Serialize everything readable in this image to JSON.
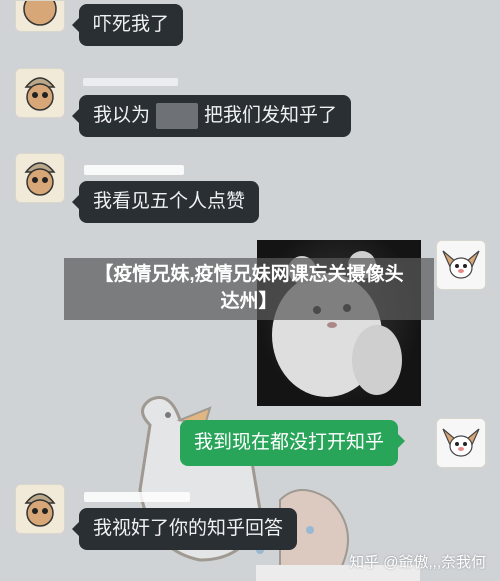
{
  "messages": [
    {
      "text": "吓死我了"
    },
    {
      "text_before": "我以为",
      "text_after": "把我们发知乎了"
    },
    {
      "text": "我看见五个人点赞"
    },
    {
      "text": "我到现在都没打开知乎"
    },
    {
      "text": "我视奸了你的知乎回答"
    }
  ],
  "banner": {
    "line1": "【疫情兄妹,疫情兄妹网课忘关摄像头",
    "line2": "达州】"
  },
  "watermark": {
    "text": "知乎 @爺傲,,,奈我何"
  },
  "icons": {
    "left_avatar": "cartoon-character-avatar-icon",
    "right_avatar": "cartoon-dog-avatar-icon"
  },
  "colors": {
    "background": "#cfd3d6",
    "bubble_dark": "#2a2f34",
    "bubble_green": "#29a55a"
  }
}
